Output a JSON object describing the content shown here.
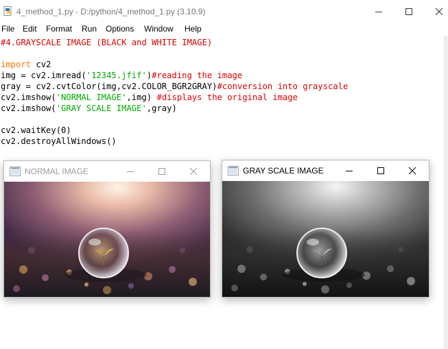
{
  "window": {
    "title": "4_method_1.py - D:/python/4_method_1.py (3.10.9)",
    "minimize_icon": "minimize-icon",
    "maximize_icon": "maximize-icon",
    "close_icon": "close-icon"
  },
  "menu": {
    "items": [
      "File",
      "Edit",
      "Format",
      "Run",
      "Options",
      "Window",
      "Help"
    ]
  },
  "editor": {
    "colors": {
      "comment": "#dd0000",
      "keyword": "#ff7700",
      "string": "#00aa00",
      "text": "#000000"
    },
    "lines": {
      "l1": {
        "comment": "#4.GRAYSCALE IMAGE (BLACK and WHITE IMAGE)"
      },
      "l3": {
        "keyword": "import",
        "rest": " cv2"
      },
      "l4": {
        "pre": "img = cv2.imread(",
        "string": "'12345.jfif'",
        "post": ")",
        "comment": "#reading the image"
      },
      "l5": {
        "pre": "gray = cv2.cvtColor(img,cv2.COLOR_BGR2GRAY)",
        "comment": "#conversion into grayscale"
      },
      "l6": {
        "pre": "cv2.imshow(",
        "string": "'NORMAL IMAGE'",
        "post": ",img) ",
        "comment": "#displays the original image"
      },
      "l7": {
        "pre": "cv2.imshow(",
        "string": "'GRAY SCALE IMAGE'",
        "post": ",gray)"
      },
      "l9": {
        "text": "cv2.waitKey(0)"
      },
      "l10": {
        "text": "cv2.destroyAllWindows()"
      }
    }
  },
  "normal_window": {
    "title": "NORMAL IMAGE"
  },
  "gray_window": {
    "title": "GRAY SCALE IMAGE"
  }
}
